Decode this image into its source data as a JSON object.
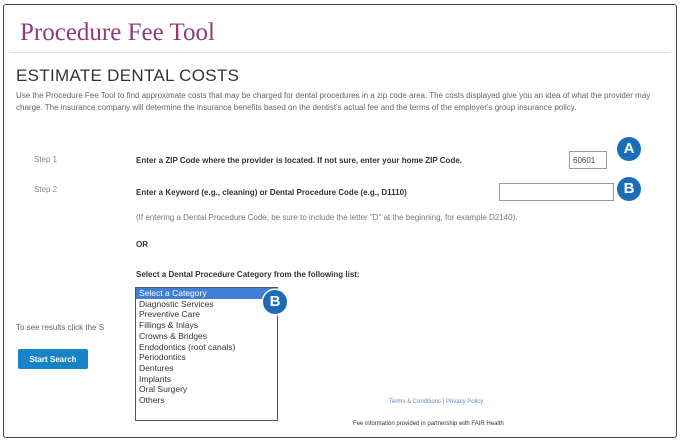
{
  "header": {
    "title": "Procedure Fee Tool",
    "section_heading": "ESTIMATE DENTAL COSTS",
    "intro": "Use the Procedure Fee Tool to find approximate costs that may be charged for dental procedures in a zip code area. The costs displayed give you an idea of what the provider may charge. The insurance company will determine the insurance benefits based on the dentist's actual fee and the terms of the employer's group insurance policy."
  },
  "step1": {
    "label": "Step 1",
    "instruction": "Enter a ZIP Code where the provider is located. If not sure, enter your home ZIP Code.",
    "zip_value": "60601",
    "badge": "A"
  },
  "step2": {
    "label": "Step 2",
    "instruction": "Enter a Keyword (e.g., cleaning) or Dental Procedure Code (e.g., D1110)",
    "keyword_value": "",
    "hint": "(If entering a Dental Procedure Code, be sure to include the letter \"D\" at the beginning, for example D2140).",
    "badge": "B",
    "or_label": "OR",
    "category_instruction": "Select a Dental Procedure Category from the following list:",
    "category_badge": "B",
    "categories": [
      "Select a Category",
      "Diagnostic Services",
      "Preventive Care",
      "Fillings & Inlays",
      "Crowns & Bridges",
      "Endodontics (root canals)",
      "Periodontics",
      "Dentures",
      "Implants",
      "Oral Surgery",
      "Others"
    ],
    "selected_category": "Select a Category"
  },
  "search": {
    "instruction_partial": "To see results click the S",
    "button_label": "Start Search"
  },
  "footer": {
    "terms_link": "Terms & Conditions",
    "separator": "|",
    "privacy_link": "Privacy Policy",
    "note": "Fee information provided in partnership with FAIR Health"
  },
  "colors": {
    "title": "#8d3c7a",
    "badge": "#1b6db8",
    "button": "#1783c7",
    "selected_option": "#3f7fd3"
  }
}
